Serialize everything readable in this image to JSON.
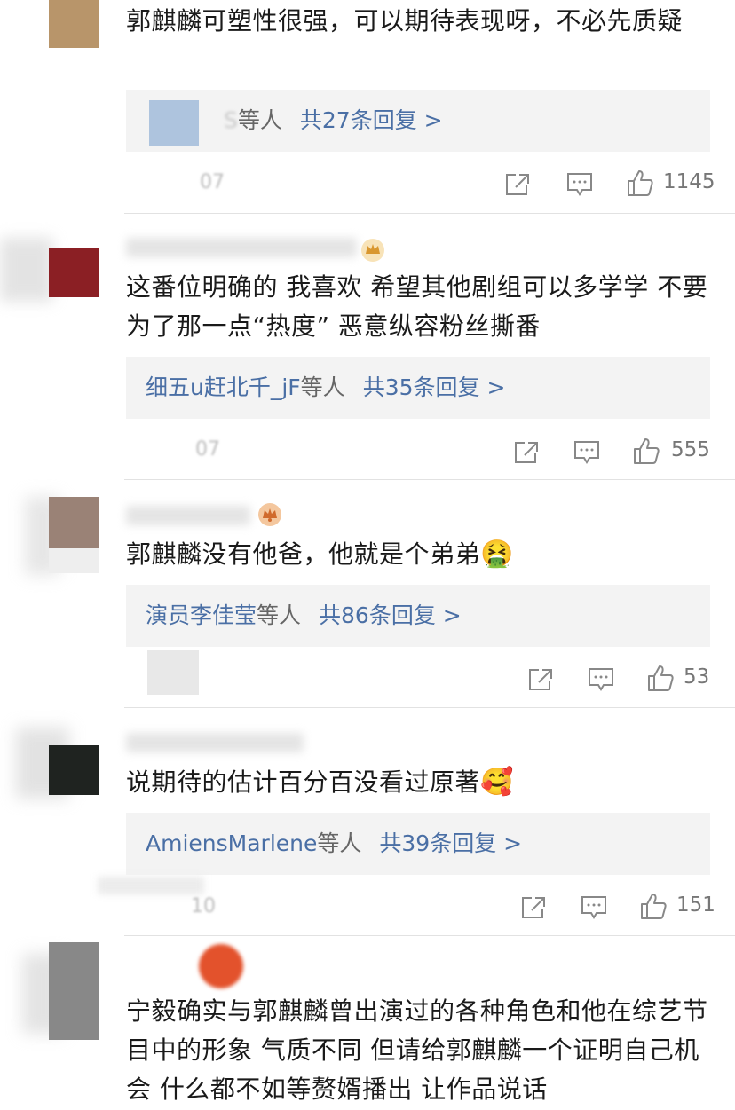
{
  "comments": [
    {
      "text": "郭麒麟可塑性很强，可以期待表现呀，不必先质疑",
      "reply_names": "S",
      "reply_deng": "等人",
      "reply_count": "共27条回复 >",
      "date": "07",
      "likes": "1145",
      "avatar_color": "#b8956a"
    },
    {
      "text": "这番位明确的 我喜欢  希望其他剧组可以多学学 不要为了那一点“热度” 恶意纵容粉丝撕番",
      "reply_names": "细五u赶北千_jF",
      "reply_deng": "等人",
      "reply_count": "共35条回复 >",
      "date": "07",
      "likes": "555",
      "avatar_color": "#8b1f24"
    },
    {
      "text": "郭麒麟没有他爸，他就是个弟弟",
      "emoji": "🤮",
      "reply_names": "演员李佳莹",
      "reply_deng": "等人",
      "reply_count": "共86条回复 >",
      "likes": "53",
      "avatar_color": "#9a8276"
    },
    {
      "text": "说期待的估计百分百没看过原著",
      "emoji": "🥰",
      "reply_names": "AmiensMarlene",
      "reply_deng": "等人",
      "reply_count": "共39条回复 >",
      "date": "10",
      "likes": "151",
      "avatar_color": "#1f2320"
    },
    {
      "text": "宁毅确实与郭麒麟曾出演过的各种角色和他在综艺节目中的形象 气质不同  但请给郭麒麟一个证明自己机会 什么都不如等赘婿播出 让作品说话",
      "avatar_color": "#888888"
    }
  ],
  "icons": {
    "share": "share-icon",
    "comment": "comment-icon",
    "like": "thumbs-up-icon",
    "crown": "crown-badge-icon"
  },
  "colors": {
    "link": "#4a6fa5",
    "reply_bg": "#f3f3f3",
    "muted": "#777777"
  }
}
